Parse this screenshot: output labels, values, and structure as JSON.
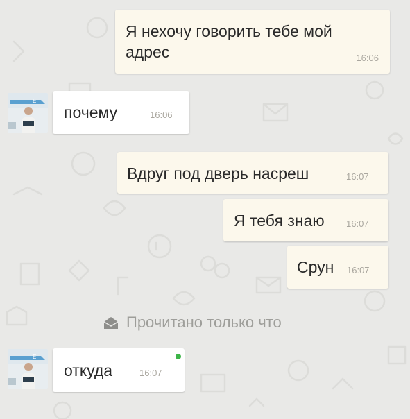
{
  "messages": [
    {
      "id": "m1",
      "lines": [
        "Я нехочу говорить тебе мой",
        "адрес"
      ],
      "time": "16:06"
    },
    {
      "id": "m2",
      "text": "почему",
      "time": "16:06"
    },
    {
      "id": "m3",
      "text": "Вдруг под дверь насреш",
      "time": "16:07"
    },
    {
      "id": "m4",
      "text": "Я тебя знаю",
      "time": "16:07"
    },
    {
      "id": "m5",
      "text": "Срун",
      "time": "16:07"
    },
    {
      "id": "m6",
      "text": "откуда",
      "time": "16:07"
    }
  ],
  "status": {
    "read_text": "Прочитано только что",
    "icon": "read-envelope-icon"
  },
  "colors": {
    "background": "#e9e9e7",
    "outgoing": "#fcf8ec",
    "incoming": "#ffffff",
    "online": "#3db548"
  }
}
